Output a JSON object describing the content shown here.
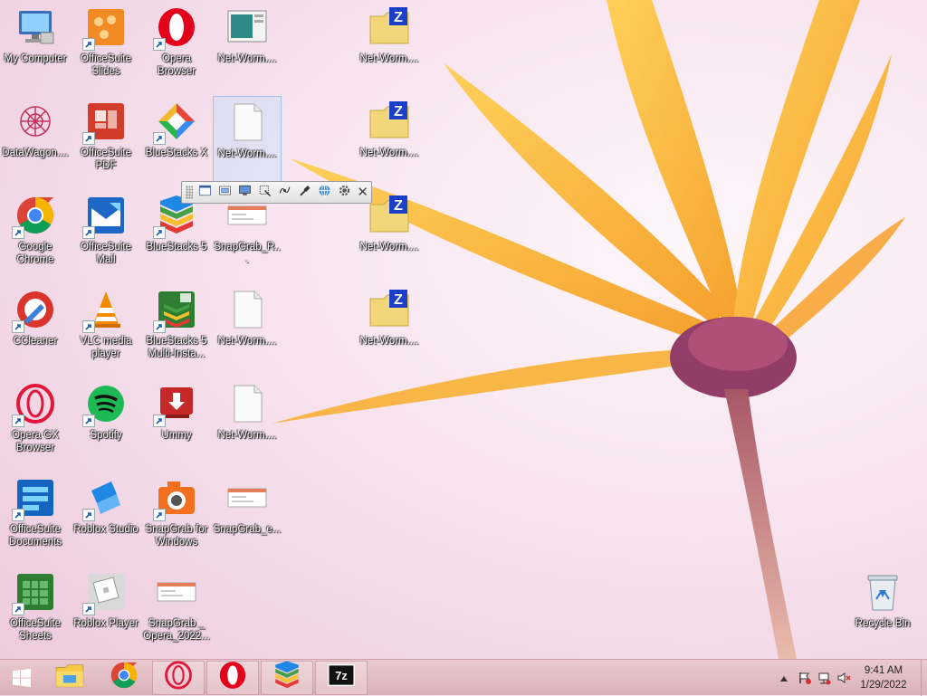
{
  "desktop": {
    "icons": [
      {
        "label": "My Computer",
        "icon": "computer-icon"
      },
      {
        "label": "OfficeSuite Slides",
        "icon": "slides-icon"
      },
      {
        "label": "Opera Browser",
        "icon": "opera-icon"
      },
      {
        "label": "Net-Worm....",
        "icon": "image-file-icon"
      },
      {
        "label": "Net-Worm....",
        "icon": "zip-folder-icon"
      },
      {
        "label": "DataWagon....",
        "icon": "datawagon-icon"
      },
      {
        "label": "OfficeSuite PDF",
        "icon": "pdf-icon"
      },
      {
        "label": "BlueStacks X",
        "icon": "bluestacks-x-icon"
      },
      {
        "label": "Net-Worm....",
        "icon": "blank-file-icon"
      },
      {
        "label": "Net-Worm....",
        "icon": "zip-folder-icon"
      },
      {
        "label": "Google Chrome",
        "icon": "chrome-icon"
      },
      {
        "label": "OfficeSuite Mail",
        "icon": "mail-icon"
      },
      {
        "label": "BlueStacks 5",
        "icon": "bluestacks-icon"
      },
      {
        "label": "SnapGrab_R...",
        "icon": "screenshot-file-icon"
      },
      {
        "label": "Net-Worm....",
        "icon": "zip-folder-icon"
      },
      {
        "label": "CCleaner",
        "icon": "ccleaner-icon"
      },
      {
        "label": "VLC media player",
        "icon": "vlc-icon"
      },
      {
        "label": "BlueStacks 5 Multi-Insta...",
        "icon": "bluestacks-multi-icon"
      },
      {
        "label": "Net-Worm....",
        "icon": "blank-file-icon"
      },
      {
        "label": "Net-Worm....",
        "icon": "zip-folder-icon"
      },
      {
        "label": "Opera GX Browser",
        "icon": "opera-gx-icon"
      },
      {
        "label": "Spotify",
        "icon": "spotify-icon"
      },
      {
        "label": "Ummy",
        "icon": "ummy-icon"
      },
      {
        "label": "Net-Worm....",
        "icon": "blank-file-icon"
      },
      {
        "label": "OfficeSuite Documents",
        "icon": "documents-icon"
      },
      {
        "label": "Roblox Studio",
        "icon": "roblox-studio-icon"
      },
      {
        "label": "SnapGrab for Windows",
        "icon": "snapgrab-icon"
      },
      {
        "label": "SnapGrab_e...",
        "icon": "screenshot-file-icon"
      },
      {
        "label": "OfficeSuite Sheets",
        "icon": "sheets-icon"
      },
      {
        "label": "Roblox Player",
        "icon": "roblox-player-icon"
      },
      {
        "label": "SnapGrab _ Opera_2022...",
        "icon": "screenshot-file-icon"
      },
      {
        "label": "Recycle Bin",
        "icon": "recycle-bin-icon"
      }
    ]
  },
  "toolbar": {
    "buttons": [
      {
        "icon": "window-capture-icon"
      },
      {
        "icon": "region-capture-icon"
      },
      {
        "icon": "fullscreen-capture-icon"
      },
      {
        "icon": "object-capture-icon"
      },
      {
        "icon": "freehand-capture-icon"
      },
      {
        "icon": "color-picker-icon"
      },
      {
        "icon": "web-capture-icon"
      },
      {
        "icon": "settings-icon"
      }
    ],
    "close_label": "✕"
  },
  "taskbar": {
    "items": [
      {
        "icon": "file-explorer-icon",
        "active": false
      },
      {
        "icon": "chrome-icon",
        "active": false
      },
      {
        "icon": "opera-gx-icon",
        "active": true
      },
      {
        "icon": "opera-icon",
        "active": true
      },
      {
        "icon": "bluestacks-icon",
        "active": true
      },
      {
        "icon": "7zip-icon",
        "active": true
      }
    ],
    "tray": {
      "icons": [
        "show-hidden-icon",
        "action-center-flag-icon",
        "network-icon",
        "volume-muted-icon"
      ],
      "time": "9:41 AM",
      "date": "1/29/2022"
    }
  }
}
